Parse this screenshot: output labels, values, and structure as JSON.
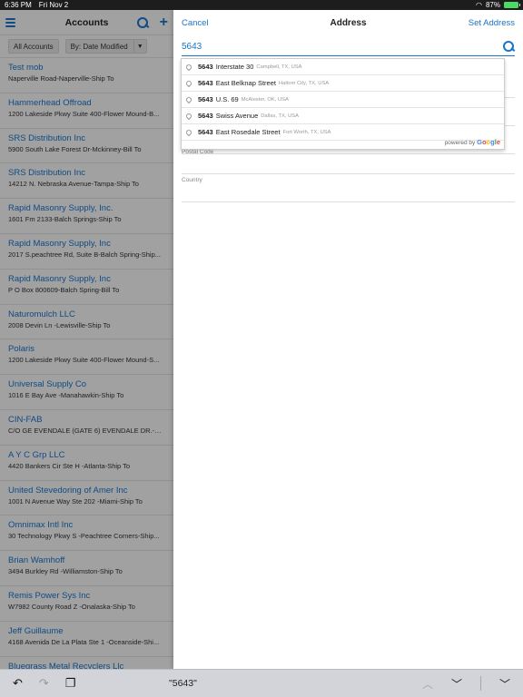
{
  "status": {
    "time": "6:36 PM",
    "date": "Fri Nov 2",
    "battery": "87%"
  },
  "master": {
    "title": "Accounts",
    "filter_all": "All Accounts",
    "filter_sort": "By: Date Modified",
    "accounts": [
      {
        "name": "Test mob",
        "address": "Naperville Road-Naperville-Ship To"
      },
      {
        "name": "Hammerhead Offroad",
        "address": "1200 Lakeside Pkwy Suite 400-Flower Mound-B..."
      },
      {
        "name": "SRS Distribution Inc",
        "address": "5900 South Lake Forest Dr-Mckinney-Bill To"
      },
      {
        "name": "SRS Distribution Inc",
        "address": "14212 N. Nebraska Avenue-Tampa-Ship To"
      },
      {
        "name": "Rapid Masonry Supply, Inc.",
        "address": "1601 Fm 2133-Balch Springs-Ship To"
      },
      {
        "name": "Rapid Masonry Supply, Inc",
        "address": "2017 S.peachtree Rd, Suite B-Balch Spring-Ship..."
      },
      {
        "name": "Rapid Masonry Supply, Inc",
        "address": "P O Box 800609-Balch Spring-Bill To"
      },
      {
        "name": "Naturomulch LLC",
        "address": "2008 Devin Ln -Lewisville-Ship To"
      },
      {
        "name": "Polaris",
        "address": "1200 Lakeside Pkwy Suite 400-Flower Mound-S..."
      },
      {
        "name": "Universal Supply Co",
        "address": "1016 E Bay Ave -Manahawkin-Ship To"
      },
      {
        "name": "CIN-FAB",
        "address": "C/O GE EVENDALE (GATE 6) EVENDALE DR.-CIN..."
      },
      {
        "name": "A Y C Grp LLC",
        "address": "4420 Bankers Cir Ste H -Atlanta-Ship To"
      },
      {
        "name": "United Stevedoring of Amer Inc",
        "address": "1001 N Avenue Way Ste 202 -Miami-Ship To"
      },
      {
        "name": "Omnimax Intl Inc",
        "address": "30 Technology Pkwy S -Peachtree Corners-Ship..."
      },
      {
        "name": "Brian Wamhoff",
        "address": "3494 Burkley Rd -Williamston-Ship To"
      },
      {
        "name": "Remis Power Sys Inc",
        "address": "W7982 County Road Z -Onalaska-Ship To"
      },
      {
        "name": "Jeff Guillaume",
        "address": "4168 Avenida De La Plata Ste 1 -Oceanside-Shi..."
      },
      {
        "name": "Bluegrass Metal Recyclers Llc",
        "address": ""
      }
    ]
  },
  "detail": {
    "cancel": "Cancel",
    "title": "Address",
    "set_address": "Set Address",
    "search_value": "5643",
    "postal_code_label": "Postal Code",
    "country_label": "Country",
    "suggestions": [
      {
        "number": "5643",
        "street": "Interstate 30",
        "location": "Campbell, TX, USA"
      },
      {
        "number": "5643",
        "street": "East Belknap Street",
        "location": "Haltom City, TX, USA"
      },
      {
        "number": "5643",
        "street": "U.S. 69",
        "location": "McAlester, OK, USA"
      },
      {
        "number": "5643",
        "street": "Swiss Avenue",
        "location": "Dallas, TX, USA"
      },
      {
        "number": "5643",
        "street": "East Rosedale Street",
        "location": "Fort Worth, TX, USA"
      }
    ],
    "powered_by": "powered by",
    "google": {
      "g1": "G",
      "o1": "o",
      "o2": "o",
      "g2": "g",
      "l": "l",
      "e": "e"
    }
  },
  "keyboard": {
    "prediction": "\"5643\""
  },
  "colors": {
    "accent": "#1a73c8"
  }
}
